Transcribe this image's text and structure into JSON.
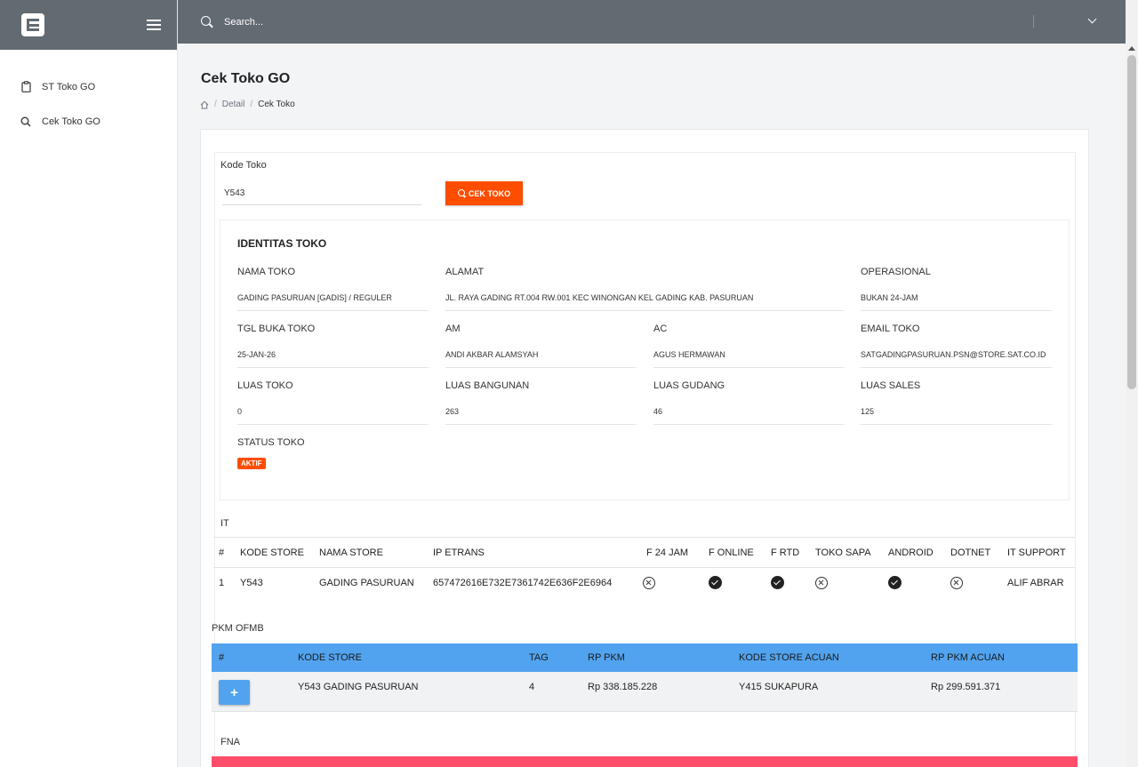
{
  "header": {
    "search_placeholder": "Search..."
  },
  "sidebar": {
    "items": [
      {
        "label": "ST Toko GO",
        "icon": "clipboard-icon"
      },
      {
        "label": "Cek Toko GO",
        "icon": "search-icon"
      }
    ]
  },
  "page": {
    "title": "Cek Toko GO",
    "breadcrumb": {
      "level1": "Detail",
      "current": "Cek Toko"
    }
  },
  "form": {
    "kode_label": "Kode Toko",
    "kode_value": "Y543",
    "button_label": "CEK TOKO"
  },
  "identitas": {
    "title": "IDENTITAS TOKO",
    "nama_toko": {
      "label": "NAMA TOKO",
      "value": "GADING PASURUAN [GADIS] / REGULER"
    },
    "alamat": {
      "label": "ALAMAT",
      "value": "JL. RAYA GADING RT.004 RW.001 KEC WINONGAN KEL GADING KAB. PASURUAN"
    },
    "operasional": {
      "label": "OPERASIONAL",
      "value": "BUKAN 24-JAM"
    },
    "tgl_buka": {
      "label": "TGL BUKA TOKO",
      "value": "25-JAN-26"
    },
    "am": {
      "label": "AM",
      "value": "ANDI AKBAR ALAMSYAH"
    },
    "ac": {
      "label": "AC",
      "value": "AGUS HERMAWAN"
    },
    "email": {
      "label": "EMAIL TOKO",
      "value": "SATGADINGPASURUAN.PSN@STORE.SAT.CO.ID"
    },
    "luas_toko": {
      "label": "LUAS TOKO",
      "value": "0"
    },
    "luas_bangunan": {
      "label": "LUAS BANGUNAN",
      "value": "263"
    },
    "luas_gudang": {
      "label": "LUAS GUDANG",
      "value": "46"
    },
    "luas_sales": {
      "label": "LUAS SALES",
      "value": "125"
    },
    "status": {
      "label": "STATUS TOKO",
      "value": "AKTIF"
    }
  },
  "it": {
    "label": "IT",
    "columns": [
      "#",
      "KODE STORE",
      "NAMA STORE",
      "IP ETRANS",
      "F 24 JAM",
      "F ONLINE",
      "F RTD",
      "TOKO SAPA",
      "ANDROID",
      "DOTNET",
      "IT SUPPORT"
    ],
    "row": {
      "no": "1",
      "kode": "Y543",
      "nama": "GADING PASURUAN",
      "ip": "657472616E732E7361742E636F2E6964",
      "f24jam": false,
      "fonline": true,
      "frtd": true,
      "tokosapa": false,
      "android": true,
      "dotnet": false,
      "support": "ALIF ABRAR"
    }
  },
  "pkm": {
    "label": "PKM OFMB",
    "columns": [
      "#",
      "KODE STORE",
      "TAG",
      "RP PKM",
      "KODE STORE ACUAN",
      "RP PKM ACUAN"
    ],
    "row": {
      "expand_label": "+",
      "kode": "Y543 GADING PASURUAN",
      "tag": "4",
      "rp_pkm": "Rp 338.185.228",
      "kode_acuan": "Y415 SUKAPURA",
      "rp_acuan": "Rp 299.591.371"
    },
    "colors": {
      "header": "#52a3ef"
    }
  },
  "fna": {
    "label": "FNA"
  },
  "colors": {
    "accent": "#ff4d00",
    "topbar": "#636b72",
    "fna_header": "#ff4d6a"
  }
}
